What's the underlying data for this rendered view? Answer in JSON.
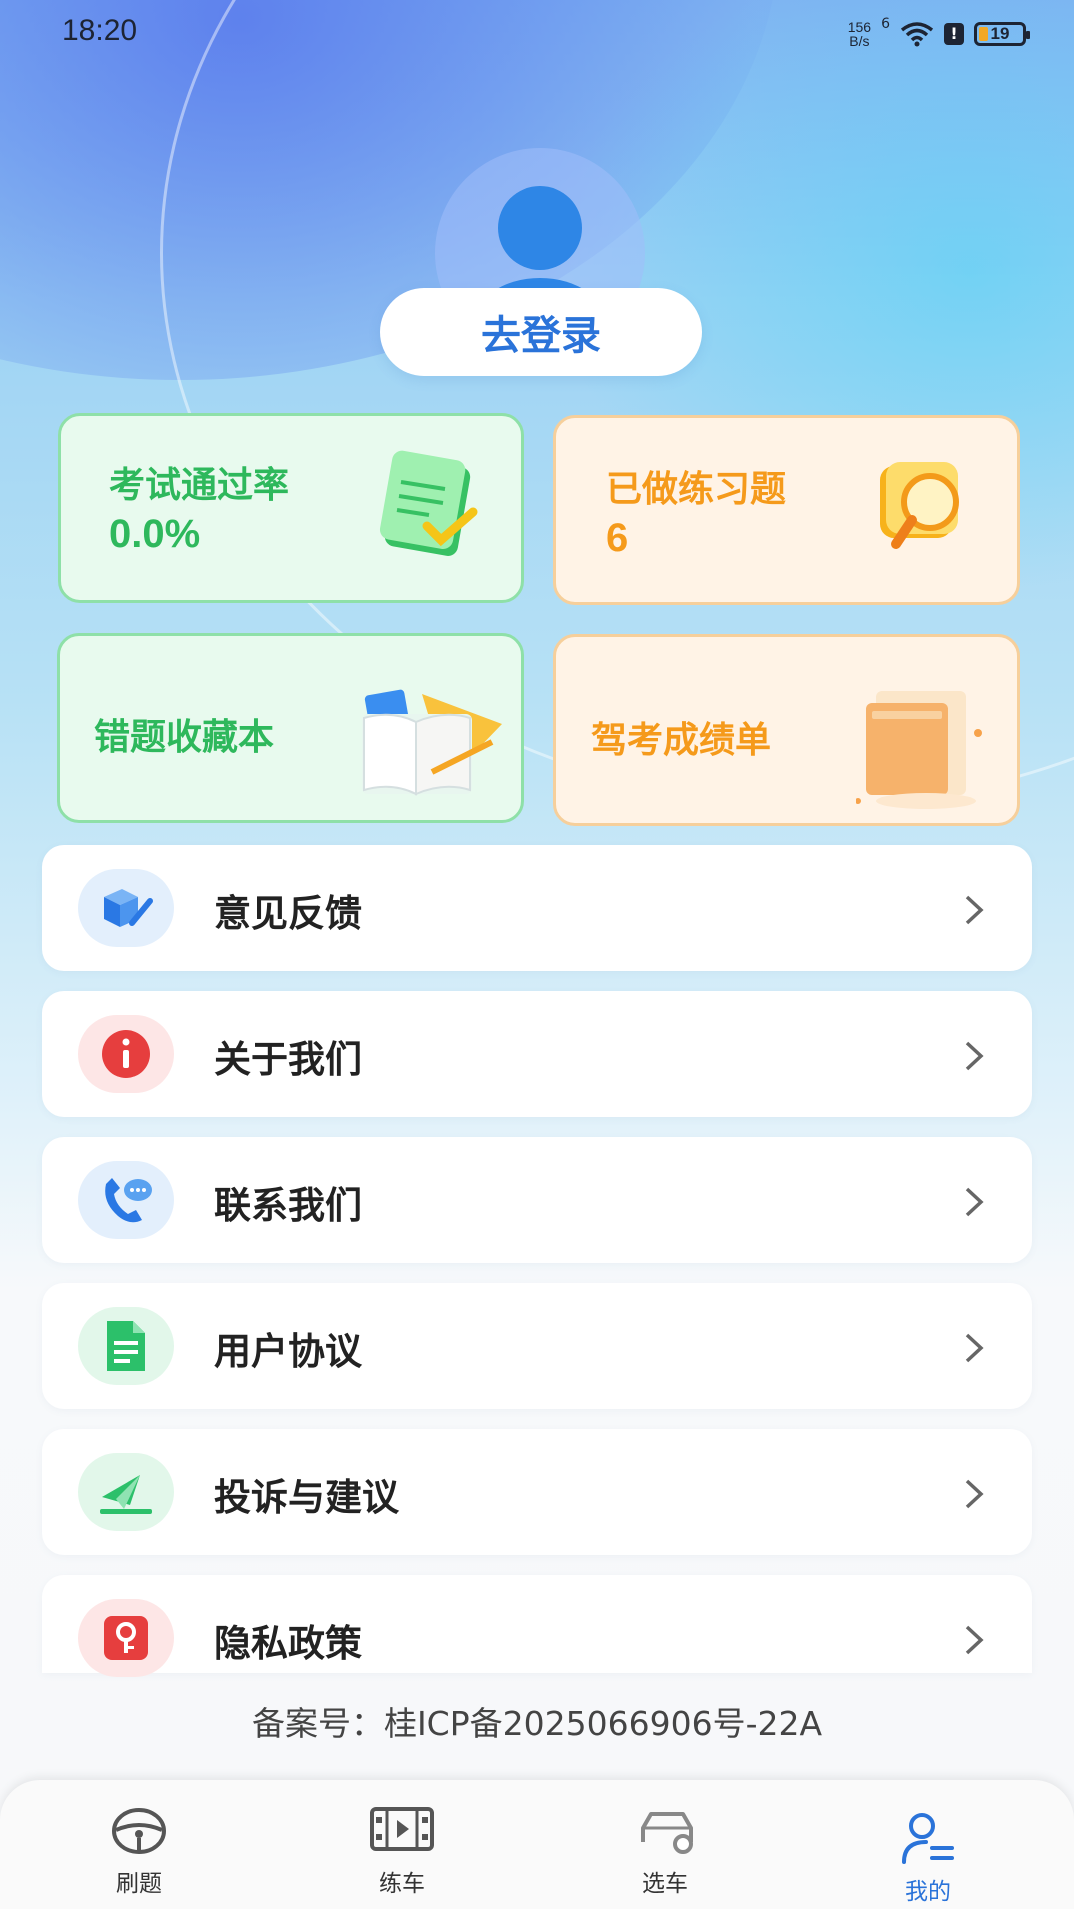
{
  "status_bar": {
    "time": "18:20",
    "net_speed_value": "156",
    "net_speed_unit": "B/s",
    "signal": "6",
    "battery": "19",
    "battery_level": 0.19
  },
  "profile": {
    "login_label": "去登录"
  },
  "cards": {
    "pass_rate": {
      "title": "考试通过率",
      "value": "0.0%"
    },
    "practiced": {
      "title": "已做练习题",
      "value": "6"
    },
    "wrong_book": {
      "title": "错题收藏本"
    },
    "report": {
      "title": "驾考成绩单"
    }
  },
  "menu": {
    "items": [
      {
        "label": "意见反馈",
        "icon": "feedback-cube-pen-icon"
      },
      {
        "label": "关于我们",
        "icon": "info-icon"
      },
      {
        "label": "联系我们",
        "icon": "phone-chat-icon"
      },
      {
        "label": "用户协议",
        "icon": "document-icon"
      },
      {
        "label": "投诉与建议",
        "icon": "send-tray-icon"
      },
      {
        "label": "隐私政策",
        "icon": "lock-key-icon"
      }
    ]
  },
  "footer": {
    "icp": "备案号：桂ICP备2025066906号-22A"
  },
  "tab_bar": {
    "tabs": [
      {
        "label": "刷题",
        "icon": "steering-wheel-icon"
      },
      {
        "label": "练车",
        "icon": "film-icon"
      },
      {
        "label": "选车",
        "icon": "car-icon"
      },
      {
        "label": "我的",
        "icon": "profile-icon"
      }
    ],
    "active": "我的"
  },
  "colors": {
    "accent": "#2a73d9",
    "green": "#2eb85c",
    "orange": "#f59a1b"
  }
}
